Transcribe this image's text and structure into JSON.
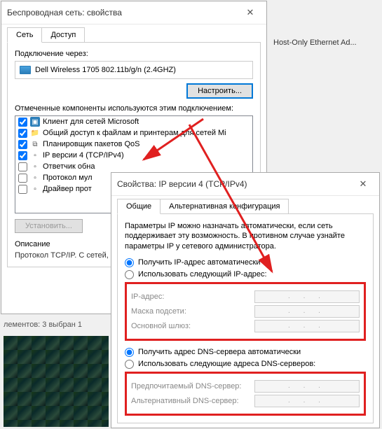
{
  "window1": {
    "title": "Беспроводная сеть: свойства",
    "tabs": {
      "network": "Сеть",
      "access": "Доступ"
    },
    "connect_via": "Подключение через:",
    "adapter_name": "Dell Wireless 1705 802.11b/g/n (2.4GHZ)",
    "configure_btn": "Настроить...",
    "components_label": "Отмеченные компоненты используются этим подключением:",
    "items": [
      {
        "label": "Клиент для сетей Microsoft",
        "checked": true
      },
      {
        "label": "Общий доступ к файлам и принтерам для сетей Mi",
        "checked": true
      },
      {
        "label": "Планировщик пакетов QoS",
        "checked": true
      },
      {
        "label": "IP версии 4 (TCP/IPv4)",
        "checked": true
      },
      {
        "label": "Ответчик обна",
        "checked": false
      },
      {
        "label": "Протокол мул",
        "checked": false
      },
      {
        "label": "Драйвер прот",
        "checked": false
      }
    ],
    "install_btn": "Установить...",
    "desc_title": "Описание",
    "desc_text": "Протокол TCP/IP. С сетей, обеспечиваю взаимодействующи"
  },
  "window2": {
    "title": "Свойства: IP версии 4 (TCP/IPv4)",
    "tabs": {
      "general": "Общие",
      "alt": "Альтернативная конфигурация"
    },
    "intro": "Параметры IP можно назначать автоматически, если сеть поддерживает эту возможность. В противном случае узнайте параметры IP у сетевого администратора.",
    "radio_auto_ip": "Получить IP-адрес автоматически",
    "radio_manual_ip": "Использовать следующий IP-адрес:",
    "ip_address": "IP-адрес:",
    "subnet": "Маска подсети:",
    "gateway": "Основной шлюз:",
    "radio_auto_dns": "Получить адрес DNS-сервера автоматически",
    "radio_manual_dns": "Использовать следующие адреса DNS-серверов:",
    "pref_dns": "Предпочитаемый DNS-сервер:",
    "alt_dns": "Альтернативный DNS-сервер:",
    "ip_placeholder": ". . ."
  },
  "background": {
    "host_only": "Host-Only Ethernet Ad...",
    "status_line": "лементов: 3     выбран 1"
  }
}
